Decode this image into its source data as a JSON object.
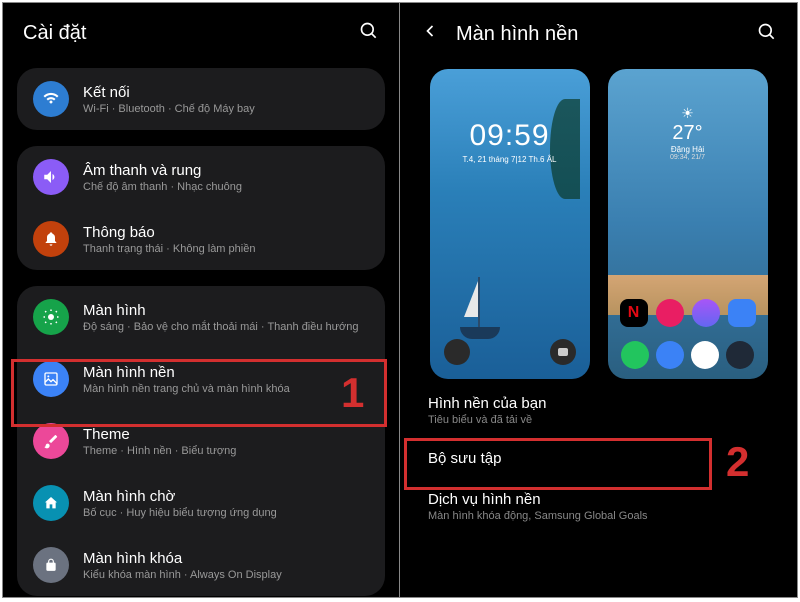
{
  "left": {
    "title": "Cài đặt",
    "groups": [
      {
        "items": [
          {
            "icon": "wifi",
            "title": "Kết nối",
            "sub": "Wi-Fi · Bluetooth · Chế độ Máy bay"
          }
        ]
      },
      {
        "items": [
          {
            "icon": "sound",
            "title": "Âm thanh và rung",
            "sub": "Chế độ âm thanh · Nhạc chuông"
          },
          {
            "icon": "notif",
            "title": "Thông báo",
            "sub": "Thanh trạng thái · Không làm phiền"
          }
        ]
      },
      {
        "items": [
          {
            "icon": "display",
            "title": "Màn hình",
            "sub": "Độ sáng · Bảo vệ cho mắt thoải mái · Thanh điều hướng"
          },
          {
            "icon": "wallpaper",
            "title": "Màn hình nền",
            "sub": "Màn hình nền trang chủ và màn hình khóa"
          },
          {
            "icon": "theme",
            "title": "Theme",
            "sub": "Theme · Hình nền · Biểu tượng"
          },
          {
            "icon": "standby",
            "title": "Màn hình chờ",
            "sub": "Bố cục · Huy hiệu biểu tượng ứng dụng"
          },
          {
            "icon": "lock",
            "title": "Màn hình khóa",
            "sub": "Kiểu khóa màn hình · Always On Display"
          }
        ]
      }
    ],
    "annotation": "1"
  },
  "right": {
    "title": "Màn hình nền",
    "lock_preview": {
      "time": "09:59",
      "date": "T.4, 21 tháng 7|12 Th.6 ÂL"
    },
    "home_preview": {
      "temp": "27°",
      "location": "Đặng Hải",
      "details": "09:34, 21/7"
    },
    "options": [
      {
        "title": "Hình nền của bạn",
        "sub": "Tiêu biểu và đã tải về"
      },
      {
        "title": "Bộ sưu tập",
        "sub": ""
      },
      {
        "title": "Dịch vụ hình nền",
        "sub": "Màn hình khóa động, Samsung Global Goals"
      }
    ],
    "annotation": "2"
  }
}
